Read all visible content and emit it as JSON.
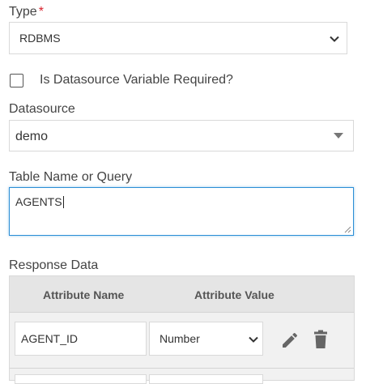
{
  "type_field": {
    "label": "Type",
    "required_mark": "*",
    "value": "RDBMS"
  },
  "datasource_variable": {
    "label": "Is Datasource Variable Required?",
    "checked": false
  },
  "datasource": {
    "label": "Datasource",
    "value": "demo"
  },
  "table_query": {
    "label": "Table Name or Query",
    "value": "AGENTS"
  },
  "response_data": {
    "label": "Response Data",
    "columns": [
      "Attribute Name",
      "Attribute Value"
    ],
    "rows": [
      {
        "name": "AGENT_ID",
        "type": "Number"
      }
    ]
  },
  "colors": {
    "required": "#d9232e",
    "focus_border": "#2b8ed6",
    "table_header": "#e5e5e5"
  },
  "icons": {
    "select_chevron": "chevron-down-icon",
    "datasource_caret": "caret-down-icon",
    "edit": "pencil-icon",
    "delete": "trash-icon"
  }
}
